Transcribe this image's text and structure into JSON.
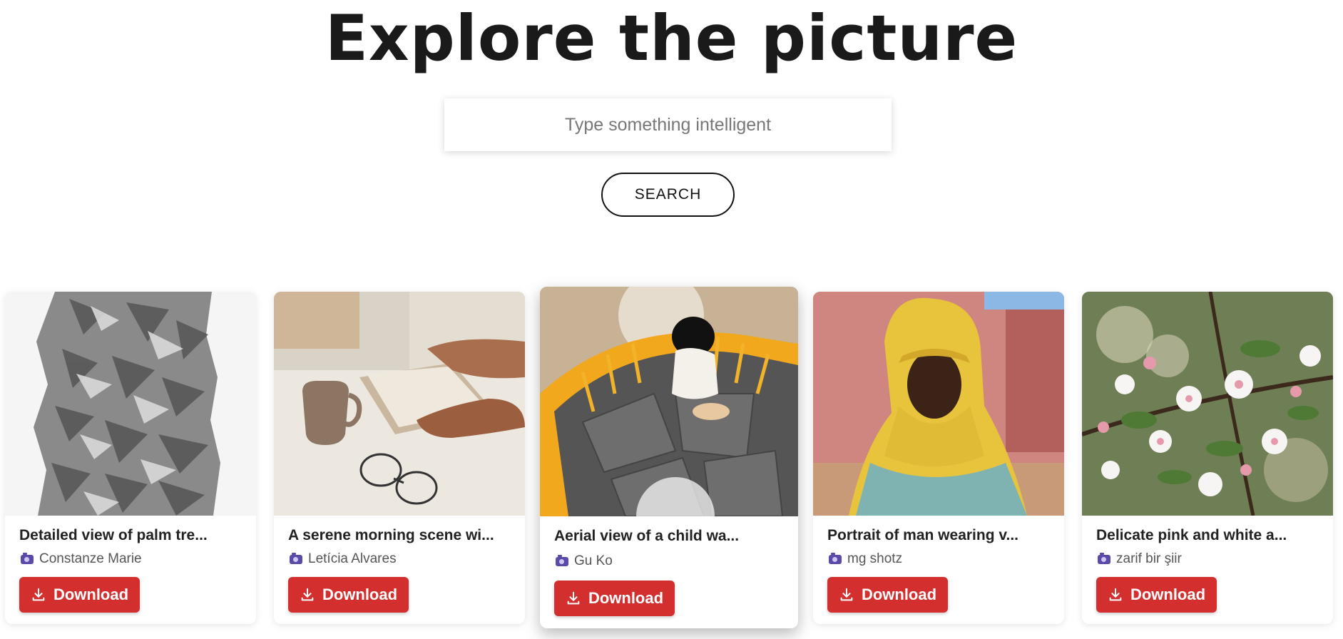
{
  "header": {
    "title": "Explore the picture"
  },
  "search": {
    "placeholder": "Type something intelligent",
    "value": "",
    "button_label": "SEARCH"
  },
  "cards": [
    {
      "caption": "Detailed view of palm tre...",
      "author": "Constanze Marie",
      "download_label": "Download"
    },
    {
      "caption": "A serene morning scene wi...",
      "author": "Letícia Alvares",
      "download_label": "Download"
    },
    {
      "caption": "Aerial view of a child wa...",
      "author": "Gu Ko",
      "download_label": "Download"
    },
    {
      "caption": "Portrait of man wearing v...",
      "author": "mg shotz",
      "download_label": "Download"
    },
    {
      "caption": "Delicate pink and white a...",
      "author": "zarif bir şiir",
      "download_label": "Download"
    }
  ],
  "colors": {
    "download_button": "#d32f2f",
    "camera_icon": "#5b4aa8"
  },
  "icons": {
    "author": "camera-icon",
    "download": "download-icon"
  }
}
